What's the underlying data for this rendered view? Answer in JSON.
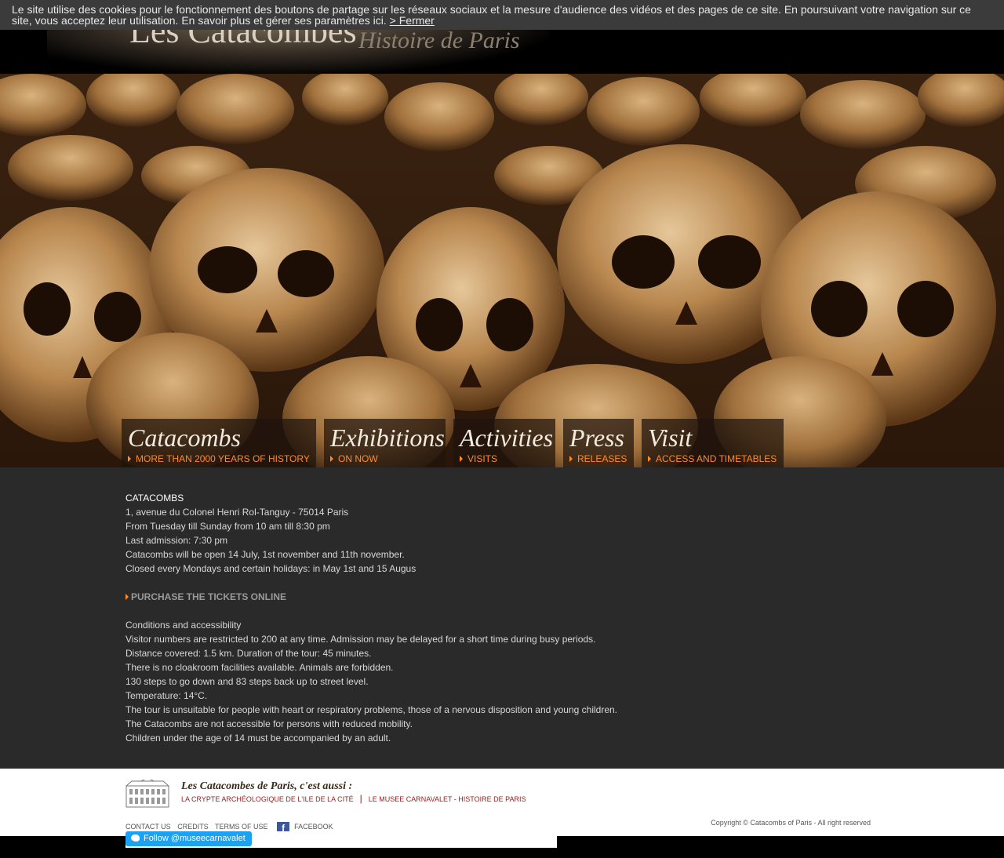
{
  "cookie_banner": {
    "text": "Le site utilise des cookies pour le fonctionnement des boutons de partage sur les réseaux sociaux et la mesure d'audience des vidéos et des pages de ce site. En poursuivant votre navigation sur ce site, vous acceptez leur utilisation. En savoir plus et gérer ses paramètres ici. ",
    "close_label": "> Fermer"
  },
  "header": {
    "logo_main": "Les Catacombes",
    "logo_sub": "Histoire de Paris"
  },
  "nav": [
    {
      "title": "Catacombs",
      "sub": "MORE THAN 2000 YEARS OF HISTORY"
    },
    {
      "title": "Exhibitions",
      "sub": "ON NOW"
    },
    {
      "title": "Activities",
      "sub": "VISITS"
    },
    {
      "title": "Press",
      "sub": "RELEASES"
    },
    {
      "title": "Visit",
      "sub": "ACCESS AND TIMETABLES"
    }
  ],
  "info": {
    "heading": "CATACOMBS",
    "lines": [
      "1, avenue du Colonel Henri Rol-Tanguy - 75014 Paris",
      "From Tuesday till Sunday from 10 am till 8:30 pm",
      "Last admission: 7:30 pm",
      "Catacombs will be open 14 July, 1st  november and 11th november.",
      "Closed every Mondays and certain holidays: in May 1st and 15 Augus"
    ],
    "tickets_label": "PURCHASE THE TICKETS ONLINE",
    "conditions": [
      "Conditions and accessibility",
      "Visitor numbers are restricted to 200 at any time. Admission may be delayed for a short time during busy periods.",
      "Distance covered: 1.5 km. Duration of the tour: 45 minutes.",
      "There is no cloakroom facilities available. Animals are forbidden.",
      "130 steps to go down and 83 steps back up to street level.",
      "Temperature: 14°C.",
      "The tour is unsuitable for people with heart or respiratory problems, those of a nervous disposition and young children.",
      "The Catacombs are not accessible for persons with reduced mobility.",
      "Children under the age of 14 must be accompanied by an adult."
    ]
  },
  "footer": {
    "also_title": "Les Catacombes de Paris, c'est aussi :",
    "link_crypte": "LA CRYPTE ARCHÉOLOGIQUE DE L'ILE DE LA CITÉ",
    "link_carnavalet": "LE MUSEE CARNAVALET - HISTOIRE DE PARIS",
    "contact": "CONTACT US",
    "credits": "CREDITS",
    "terms": "TERMS OF USE",
    "facebook": "FACEBOOK",
    "copyright": "Copyright © Catacombs of Paris - All right reserved",
    "twitter": "Follow @museecarnavalet"
  },
  "colors": {
    "accent": "#ff8a2a",
    "background": "#2a2a2a",
    "link_red": "#9b1b1b"
  }
}
